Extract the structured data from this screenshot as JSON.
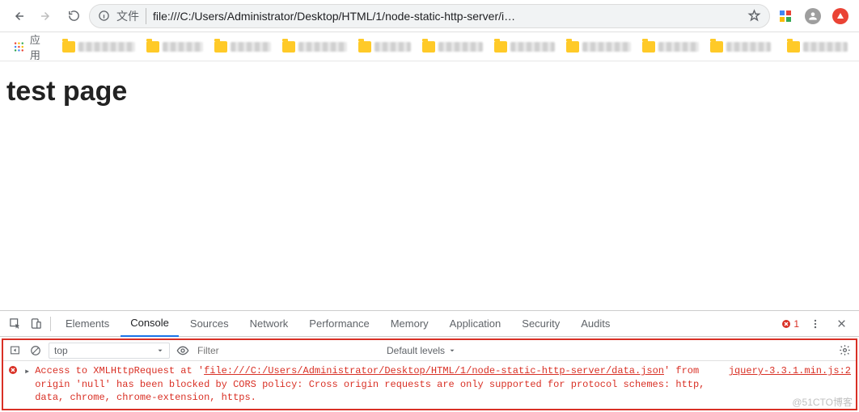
{
  "toolbar": {
    "file_label": "文件",
    "url": "file:///C:/Users/Administrator/Desktop/HTML/1/node-static-http-server/i…"
  },
  "bookmarks": {
    "apps_label": "应用"
  },
  "page": {
    "heading": "test page"
  },
  "devtools": {
    "tabs": {
      "elements": "Elements",
      "console": "Console",
      "sources": "Sources",
      "network": "Network",
      "performance": "Performance",
      "memory": "Memory",
      "application": "Application",
      "security": "Security",
      "audits": "Audits"
    },
    "error_count": "1"
  },
  "console": {
    "context_label": "top",
    "filter_placeholder": "Filter",
    "levels_label": "Default levels",
    "message_prefix": "Access to XMLHttpRequest at '",
    "message_url": "file:///C:/Users/Administrator/Desktop/HTML/1/node-static-http-server/data.json",
    "message_suffix": "' from origin 'null' has been blocked by CORS policy: Cross origin requests are only supported for protocol schemes: http, data, chrome, chrome-extension, https.",
    "source_link": "jquery-3.3.1.min.js:2"
  },
  "watermark": "@51CTO博客"
}
